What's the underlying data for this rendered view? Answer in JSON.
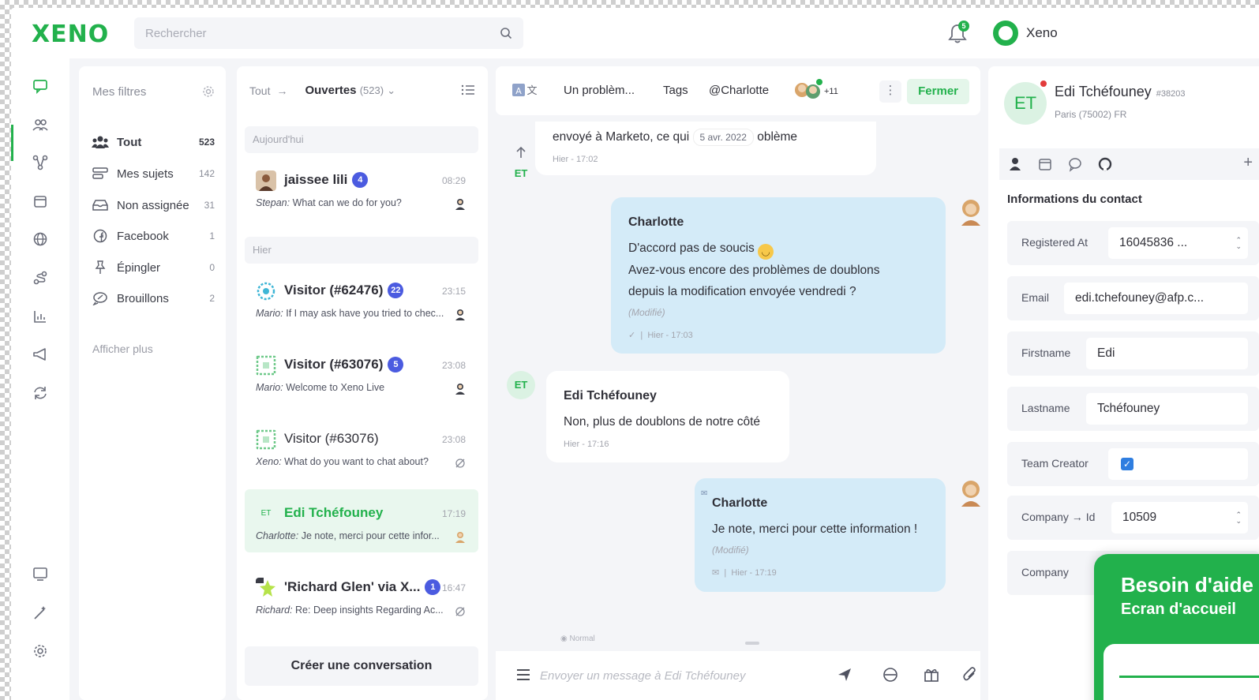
{
  "brand": {
    "logo": "XENO",
    "accent": "#22b14c",
    "org_name": "Xeno",
    "notification_count": "5"
  },
  "search": {
    "placeholder": "Rechercher"
  },
  "filters": {
    "title": "Mes filtres",
    "items": [
      {
        "label": "Tout",
        "count": "523",
        "icon": "users-icon"
      },
      {
        "label": "Mes sujets",
        "count": "142",
        "icon": "stack-icon"
      },
      {
        "label": "Non assignée",
        "count": "31",
        "icon": "inbox-icon"
      },
      {
        "label": "Facebook",
        "count": "1",
        "icon": "facebook-icon"
      },
      {
        "label": "Épingler",
        "count": "0",
        "icon": "pin-icon"
      },
      {
        "label": "Brouillons",
        "count": "2",
        "icon": "draft-icon"
      }
    ],
    "more": "Afficher plus"
  },
  "conversations": {
    "crumb": "Tout",
    "status": "Ouvertes",
    "status_count": "(523)",
    "groups": {
      "today": "Aujourd'hui",
      "yesterday": "Hier"
    },
    "items": [
      {
        "name": "jaissee lili",
        "badge": "4",
        "time": "08:29",
        "author": "Stepan:",
        "preview": "What can we do for you?"
      },
      {
        "name": "Visitor (#62476)",
        "badge": "22",
        "time": "23:15",
        "author": "Mario:",
        "preview": "If I may ask have you tried to chec..."
      },
      {
        "name": "Visitor (#63076)",
        "badge": "5",
        "time": "23:08",
        "author": "Mario:",
        "preview": "Welcome to Xeno Live"
      },
      {
        "name": "Visitor (#63076)",
        "badge": "",
        "time": "23:08",
        "author": "Xeno:",
        "preview": "What do you want to chat about?"
      },
      {
        "name": "Edi Tchéfouney",
        "avatar": "ET",
        "badge": "",
        "time": "17:19",
        "author": "Charlotte:",
        "preview": "Je note, merci pour cette infor..."
      },
      {
        "name": "'Richard Glen' via X...",
        "badge": "1",
        "time": "16:47",
        "author": "Richard:",
        "preview": "Re: Deep insights Regarding Ac..."
      }
    ],
    "create_button": "Créer une conversation"
  },
  "chat": {
    "header": {
      "subject": "Un problèm...",
      "tags": "Tags",
      "assignee": "@Charlotte",
      "participants_more": "+11",
      "close": "Fermer"
    },
    "messages": [
      {
        "text_start": "envoyé à Marketo, ce qui",
        "date_chip": "5 avr. 2022",
        "text_end": "oblème",
        "meta": "Hier - 17:02"
      },
      {
        "author": "Charlotte",
        "line1": "D'accord pas de soucis",
        "line2": "Avez-vous encore des problèmes de doublons",
        "line3": "depuis la modification envoyée vendredi ?",
        "edited": "(Modifié)",
        "meta": "Hier - 17:03"
      },
      {
        "author": "Edi Tchéfouney",
        "text": "Non, plus de doublons de notre côté",
        "meta": "Hier - 17:16"
      },
      {
        "author": "Charlotte",
        "text": "Je note, merci pour cette information !",
        "edited": "(Modifié)",
        "meta": "Hier - 17:19"
      }
    ],
    "contact_initials": "ET",
    "mode": "Normal",
    "compose_placeholder": "Envoyer un message à Edi Tchéfouney"
  },
  "contact": {
    "initials": "ET",
    "name": "Edi Tchéfouney",
    "id": "#38203",
    "location": "Paris (75002) FR",
    "section_title": "Informations du contact",
    "fields": {
      "registered_at": {
        "label": "Registered At",
        "value": "16045836 ..."
      },
      "email": {
        "label": "Email",
        "value": "edi.tchefouney@afp.c..."
      },
      "firstname": {
        "label": "Firstname",
        "value": "Edi"
      },
      "lastname": {
        "label": "Lastname",
        "value": "Tchéfouney"
      },
      "team_creator": {
        "label": "Team Creator",
        "checked": true
      },
      "company_id": {
        "label": "Company → Id",
        "value": "10509"
      },
      "company": {
        "label": "Company"
      }
    }
  },
  "help_widget": {
    "title": "Besoin d'aide ?",
    "subtitle": "Ecran d'accueil"
  }
}
